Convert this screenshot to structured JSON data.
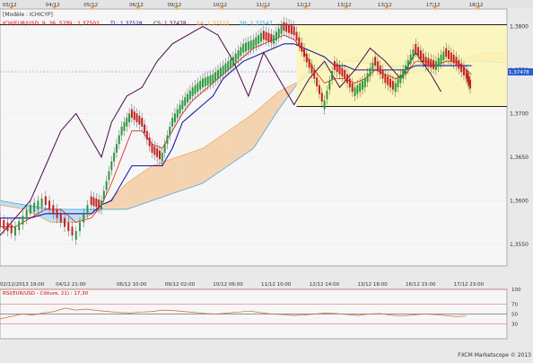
{
  "chart_data": [
    {
      "type": "candlestick",
      "title_line": "[Modèle : ICHICYP]",
      "indicator_label": "ICH(EUR/USD, 9, 26, 52)",
      "legend": [
        {
          "name": "SL",
          "value": "1,37502",
          "color": "#d40000"
        },
        {
          "name": "TL",
          "value": "1,37528",
          "color": "#1a1ab0"
        },
        {
          "name": "CS",
          "value": "1,37478",
          "color": "#4a0a4a"
        },
        {
          "name": "SA",
          "value": "1,37515",
          "color": "#f0a050"
        },
        {
          "name": "SB",
          "value": "1,37547",
          "color": "#3aa0d8"
        }
      ],
      "top_dates": [
        "03/12",
        "04/12",
        "05/12",
        "06/12",
        "09/12",
        "10/12",
        "11/12",
        "12/12",
        "13/12",
        "13/12",
        "17/12",
        "18/12"
      ],
      "bottom_dates": [
        "02/12/2013 19:00",
        "04/12 21:00",
        "06/12 10:00",
        "09/12 02:00",
        "10/12 06:00",
        "11/12 10:00",
        "12/12 14:00",
        "13/12 18:00",
        "16/12 15:00",
        "17/12 23:00"
      ],
      "y_ticks": [
        "1,3800",
        "1,3750",
        "1,3700",
        "1,3650",
        "1,3600",
        "1,3550"
      ],
      "y_tick_values": [
        1.38,
        1.375,
        1.37,
        1.365,
        1.36,
        1.355
      ],
      "ylim": [
        1.3525,
        1.382
      ],
      "current_price": "1,37478",
      "current_price_value": 1.37478,
      "highlight_box": {
        "x_start": 0.585,
        "x_end": 1.0,
        "y_low": 1.3708,
        "y_high": 1.3802
      },
      "price_x": [
        0,
        0.03,
        0.06,
        0.09,
        0.12,
        0.15,
        0.18,
        0.2,
        0.22,
        0.24,
        0.26,
        0.28,
        0.3,
        0.32,
        0.34,
        0.36,
        0.38,
        0.4,
        0.42,
        0.44,
        0.46,
        0.48,
        0.5,
        0.52,
        0.54,
        0.56,
        0.58,
        0.6,
        0.62,
        0.64,
        0.66,
        0.68,
        0.7,
        0.72,
        0.74,
        0.76,
        0.78,
        0.8,
        0.82,
        0.84,
        0.86,
        0.88,
        0.9,
        0.92,
        0.93
      ],
      "price_y": [
        1.3575,
        1.3565,
        1.359,
        1.36,
        1.358,
        1.356,
        1.36,
        1.3595,
        1.364,
        1.368,
        1.37,
        1.369,
        1.366,
        1.365,
        1.369,
        1.371,
        1.3725,
        1.3735,
        1.374,
        1.375,
        1.376,
        1.3775,
        1.378,
        1.379,
        1.3785,
        1.38,
        1.3795,
        1.377,
        1.3745,
        1.371,
        1.3755,
        1.3745,
        1.3725,
        1.3735,
        1.376,
        1.374,
        1.373,
        1.375,
        1.3775,
        1.376,
        1.3755,
        1.377,
        1.376,
        1.3745,
        1.373
      ],
      "tenkan_y": [
        1.357,
        1.357,
        1.358,
        1.359,
        1.359,
        1.3575,
        1.358,
        1.3595,
        1.362,
        1.365,
        1.368,
        1.368,
        1.3665,
        1.366,
        1.368,
        1.37,
        1.3715,
        1.3725,
        1.3735,
        1.3745,
        1.3755,
        1.3765,
        1.3775,
        1.378,
        1.3785,
        1.379,
        1.3785,
        1.377,
        1.375,
        1.3735,
        1.374,
        1.374,
        1.3735,
        1.374,
        1.375,
        1.3745,
        1.374,
        1.3745,
        1.376,
        1.376,
        1.3755,
        1.376,
        1.376,
        1.375,
        1.3745
      ],
      "kijun_y": [
        1.358,
        1.358,
        1.358,
        1.3585,
        1.3585,
        1.3585,
        1.3585,
        1.3595,
        1.36,
        1.362,
        1.364,
        1.364,
        1.364,
        1.364,
        1.366,
        1.369,
        1.37,
        1.371,
        1.372,
        1.374,
        1.375,
        1.376,
        1.3765,
        1.377,
        1.3775,
        1.378,
        1.378,
        1.3775,
        1.377,
        1.3765,
        1.3755,
        1.3755,
        1.375,
        1.375,
        1.375,
        1.375,
        1.375,
        1.375,
        1.3755,
        1.3755,
        1.3755,
        1.3755,
        1.3755,
        1.3755,
        1.3755
      ],
      "chikou_x": [
        0.0,
        0.03,
        0.06,
        0.09,
        0.12,
        0.15,
        0.18,
        0.2,
        0.22,
        0.25,
        0.28,
        0.31,
        0.34,
        0.37,
        0.4,
        0.43,
        0.46,
        0.49,
        0.52,
        0.55,
        0.58,
        0.61,
        0.64,
        0.67,
        0.7,
        0.73,
        0.76,
        0.79,
        0.82,
        0.85,
        0.87
      ],
      "chikou_y": [
        1.356,
        1.358,
        1.36,
        1.364,
        1.368,
        1.37,
        1.367,
        1.365,
        1.369,
        1.372,
        1.373,
        1.376,
        1.378,
        1.379,
        1.38,
        1.379,
        1.376,
        1.372,
        1.377,
        1.374,
        1.371,
        1.374,
        1.376,
        1.373,
        1.375,
        1.3775,
        1.376,
        1.374,
        1.377,
        1.3745,
        1.3725
      ],
      "cloud_x": [
        0.0,
        0.05,
        0.1,
        0.15,
        0.2,
        0.25,
        0.3,
        0.35,
        0.4,
        0.45,
        0.5,
        0.55,
        0.6,
        0.65,
        0.7,
        0.75,
        0.8,
        0.85,
        0.9,
        0.95,
        1.0
      ],
      "span_a": [
        1.3595,
        1.359,
        1.3575,
        1.3575,
        1.359,
        1.362,
        1.364,
        1.365,
        1.366,
        1.368,
        1.37,
        1.3725,
        1.374,
        1.3755,
        1.3765,
        1.376,
        1.3745,
        1.375,
        1.376,
        1.377,
        1.377
      ],
      "span_b": [
        1.36,
        1.3595,
        1.359,
        1.359,
        1.359,
        1.359,
        1.36,
        1.361,
        1.362,
        1.364,
        1.366,
        1.3705,
        1.3745,
        1.376,
        1.376,
        1.3755,
        1.3755,
        1.3758,
        1.376,
        1.376,
        1.3758
      ],
      "rsi": {
        "label": "RSI(EUR/USD - Clôture, 21) : 17,30",
        "levels": [
          100,
          70,
          50,
          30
        ],
        "level_labels": [
          "100",
          "70",
          "50",
          "30"
        ],
        "values": [
          40,
          45,
          50,
          48,
          52,
          55,
          62,
          58,
          60,
          57,
          55,
          53,
          52,
          54,
          55,
          58,
          57,
          55,
          53,
          51,
          50,
          52,
          54,
          56,
          53,
          50,
          49,
          47,
          48,
          50,
          52,
          51,
          49,
          47,
          50,
          51,
          48,
          46,
          48,
          50,
          49,
          47,
          45,
          46
        ]
      },
      "watermark": "FXCM Marketscope © 2013"
    }
  ]
}
